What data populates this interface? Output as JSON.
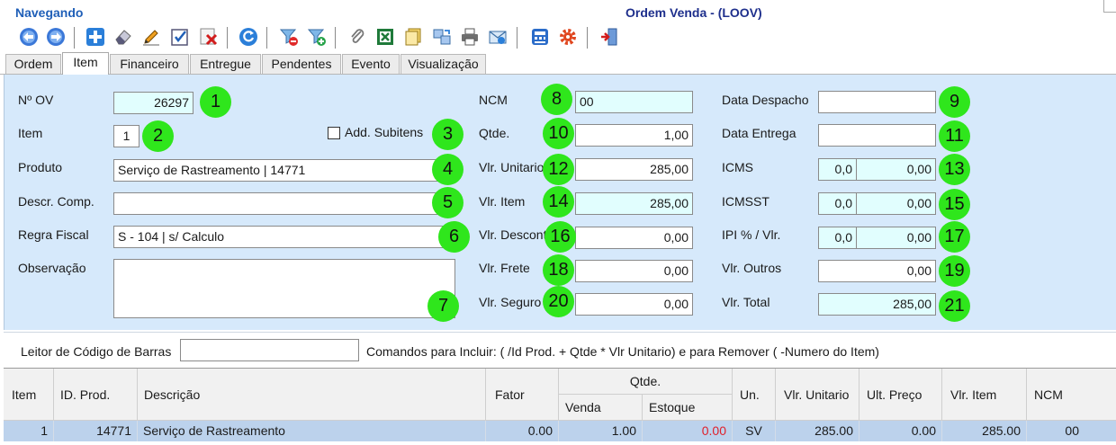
{
  "status": {
    "mode": "Navegando"
  },
  "window": {
    "title": "Ordem Venda - (LOOV)"
  },
  "toolbar": {
    "buttons": [
      "back-arrow-icon",
      "forward-arrow-icon",
      "add-icon",
      "eraser-icon",
      "pencil-edit-icon",
      "check-edit-icon",
      "delete-icon",
      "refresh-icon",
      "filter-remove-icon",
      "filter-add-icon",
      "paperclip-icon",
      "excel-icon",
      "documents-icon",
      "transfer-icon",
      "printer-icon",
      "email-icon",
      "calculator-icon",
      "gear-icon",
      "exit-icon"
    ]
  },
  "tabs": [
    "Ordem",
    "Item",
    "Financeiro",
    "Entregue",
    "Pendentes",
    "Evento",
    "Visualização"
  ],
  "form": {
    "ov_label": "Nº OV",
    "ov_value": "26297",
    "item_label": "Item",
    "item_value": "1",
    "add_subitens_label": "Add. Subitens",
    "produto_label": "Produto",
    "produto_value": "Serviço de Rastreamento | 14771",
    "descr_label": "Descr. Comp.",
    "descr_value": "",
    "regra_label": "Regra Fiscal",
    "regra_value": "S - 104 | s/ Calculo",
    "obs_label": "Observação",
    "obs_value": "",
    "ncm_label": "NCM",
    "ncm_value": "00",
    "qtde_label": "Qtde.",
    "qtde_value": "1,00",
    "vlr_unit_label": "Vlr. Unitario",
    "vlr_unit_value": "285,00",
    "vlr_item_label": "Vlr. Item",
    "vlr_item_value": "285,00",
    "vlr_desc_label": "Vlr. Desconto",
    "vlr_desc_value": "0,00",
    "vlr_frete_label": "Vlr. Frete",
    "vlr_frete_value": "0,00",
    "vlr_seguro_label": "Vlr. Seguro",
    "vlr_seguro_value": "0,00",
    "data_despacho_label": "Data Despacho",
    "data_despacho_value": "",
    "data_entrega_label": "Data Entrega",
    "data_entrega_value": "",
    "icms_label": "ICMS",
    "icms_pct": "0,0",
    "icms_value": "0,00",
    "icmsst_label": "ICMSST",
    "icmsst_pct": "0,0",
    "icmsst_value": "0,00",
    "ipi_label": "IPI % / Vlr.",
    "ipi_pct": "0,0",
    "ipi_value": "0,00",
    "vlr_outros_label": "Vlr. Outros",
    "vlr_outros_value": "0,00",
    "vlr_total_label": "Vlr. Total",
    "vlr_total_value": "285,00",
    "badges": [
      "1",
      "2",
      "3",
      "4",
      "5",
      "6",
      "7",
      "8",
      "9",
      "10",
      "11",
      "12",
      "13",
      "14",
      "15",
      "16",
      "17",
      "18",
      "19",
      "20",
      "21"
    ]
  },
  "barcode": {
    "label": "Leitor de Código de Barras",
    "value": "",
    "hint": "Comandos para Incluir: ( /Id Prod. + Qtde * Vlr Unitario) e para Remover ( -Numero do Item)"
  },
  "grid": {
    "headers": {
      "item": "Item",
      "id_prod": "ID. Prod.",
      "descricao": "Descrição",
      "fator": "Fator",
      "qtde": "Qtde.",
      "venda": "Venda",
      "estoque": "Estoque",
      "un": "Un.",
      "vlr_unitario": "Vlr. Unitario",
      "ult_preco": "Ult. Preço",
      "vlr_item": "Vlr. Item",
      "ncm": "NCM"
    },
    "rows": [
      {
        "item": "1",
        "id_prod": "14771",
        "descricao": "Serviço de Rastreamento",
        "fator": "0.00",
        "venda": "1.00",
        "estoque": "0.00",
        "un": "SV",
        "vlr_unitario": "285.00",
        "ult_preco": "0.00",
        "vlr_item": "285.00",
        "ncm": "00"
      }
    ]
  },
  "colors": {
    "panel": "#d6e9fb",
    "highlight_field": "#e1fefe",
    "badge": "#2fe61c",
    "negative": "#e0202a",
    "selected_row": "#bcd2ec"
  }
}
